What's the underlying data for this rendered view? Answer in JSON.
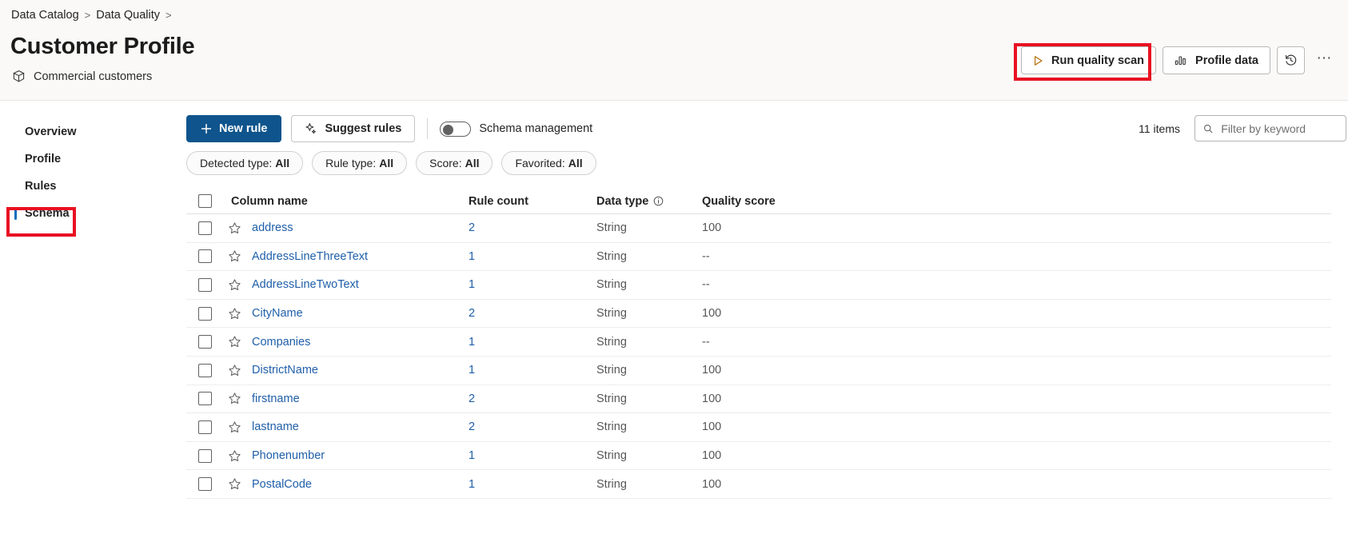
{
  "breadcrumb": {
    "items": [
      "Data Catalog",
      "Data Quality"
    ],
    "separator": ">"
  },
  "header": {
    "title": "Customer Profile",
    "subtitle": "Commercial customers",
    "subtitle_icon": "package-cube-icon",
    "actions": {
      "run_quality_scan": "Run quality scan",
      "run_quality_scan_icon": "play-triangle-icon",
      "profile_data": "Profile data",
      "profile_data_icon": "bar-chart-icon",
      "history_icon": "history-clock-icon",
      "more_icon": "ellipsis-icon",
      "more_label": "···"
    }
  },
  "sidebar": {
    "items": [
      {
        "label": "Overview",
        "selected": false
      },
      {
        "label": "Profile",
        "selected": false
      },
      {
        "label": "Rules",
        "selected": false
      },
      {
        "label": "Schema",
        "selected": true
      }
    ]
  },
  "toolbar": {
    "new_rule": "New rule",
    "new_rule_icon": "plus-icon",
    "suggest_rules": "Suggest rules",
    "suggest_rules_icon": "sparkle-icon",
    "schema_management_label": "Schema management",
    "schema_management_on": false,
    "item_count": "11 items",
    "search_placeholder": "Filter by keyword",
    "search_value": "",
    "search_icon": "search-icon"
  },
  "filters": [
    {
      "name": "Detected type",
      "value": "All"
    },
    {
      "name": "Rule type",
      "value": "All"
    },
    {
      "name": "Score",
      "value": "All"
    },
    {
      "name": "Favorited",
      "value": "All"
    }
  ],
  "table": {
    "columns": [
      "Column name",
      "Rule count",
      "Data type",
      "Quality score"
    ],
    "data_type_info_icon": "info-circle-icon",
    "select_all_checkbox": false,
    "rows": [
      {
        "name": "address",
        "rule_count": "2",
        "data_type": "String",
        "quality_score": "100",
        "favorited": false
      },
      {
        "name": "AddressLineThreeText",
        "rule_count": "1",
        "data_type": "String",
        "quality_score": "--",
        "favorited": false
      },
      {
        "name": "AddressLineTwoText",
        "rule_count": "1",
        "data_type": "String",
        "quality_score": "--",
        "favorited": false
      },
      {
        "name": "CityName",
        "rule_count": "2",
        "data_type": "String",
        "quality_score": "100",
        "favorited": false
      },
      {
        "name": "Companies",
        "rule_count": "1",
        "data_type": "String",
        "quality_score": "--",
        "favorited": false
      },
      {
        "name": "DistrictName",
        "rule_count": "1",
        "data_type": "String",
        "quality_score": "100",
        "favorited": false
      },
      {
        "name": "firstname",
        "rule_count": "2",
        "data_type": "String",
        "quality_score": "100",
        "favorited": false
      },
      {
        "name": "lastname",
        "rule_count": "2",
        "data_type": "String",
        "quality_score": "100",
        "favorited": false
      },
      {
        "name": "Phonenumber",
        "rule_count": "1",
        "data_type": "String",
        "quality_score": "100",
        "favorited": false
      },
      {
        "name": "PostalCode",
        "rule_count": "1",
        "data_type": "String",
        "quality_score": "100",
        "favorited": false
      }
    ]
  },
  "annotations": {
    "color": "#e81123",
    "targets": [
      "run-quality-scan-button",
      "sidebar-item-schema"
    ]
  }
}
